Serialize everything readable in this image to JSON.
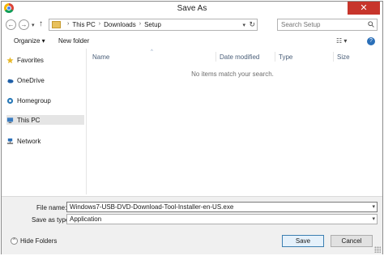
{
  "window": {
    "title": "Save As",
    "close_glyph": "✕"
  },
  "nav": {
    "back_glyph": "←",
    "forward_glyph": "→",
    "recent_glyph": "▾",
    "up_glyph": "↑"
  },
  "address": {
    "crumbs": [
      "This PC",
      "Downloads",
      "Setup"
    ],
    "separator": "›",
    "dropdown_glyph": "▾",
    "refresh_glyph": "↻"
  },
  "search": {
    "placeholder": "Search Setup"
  },
  "toolbar": {
    "organize_label": "Organize ▾",
    "new_folder_label": "New folder",
    "view_glyph": "☷ ▾",
    "help_glyph": "?"
  },
  "sidebar": {
    "items": [
      {
        "label": "Favorites",
        "icon": "star-icon",
        "color": "#e8b828"
      },
      {
        "label": "OneDrive",
        "icon": "cloud-icon",
        "color": "#1f5fa8"
      },
      {
        "label": "Homegroup",
        "icon": "homegroup-icon",
        "color": "#2a7ab8"
      },
      {
        "label": "This PC",
        "icon": "computer-icon",
        "color": "#3a7cc0"
      },
      {
        "label": "Network",
        "icon": "network-icon",
        "color": "#2a6fb8"
      }
    ],
    "selected_index": 3
  },
  "columns": {
    "name": "Name",
    "date_modified": "Date modified",
    "type": "Type",
    "size": "Size",
    "sort_glyph": "^"
  },
  "content": {
    "empty_message": "No items match your search."
  },
  "form": {
    "file_name_label": "File name:",
    "file_name_value": "Windows7-USB-DVD-Download-Tool-Installer-en-US.exe",
    "save_as_type_label": "Save as type:",
    "save_as_type_value": "Application",
    "dropdown_glyph": "▾"
  },
  "footer": {
    "hide_folders_label": "Hide Folders",
    "hide_folders_glyph": "^",
    "save_label": "Save",
    "cancel_label": "Cancel"
  }
}
